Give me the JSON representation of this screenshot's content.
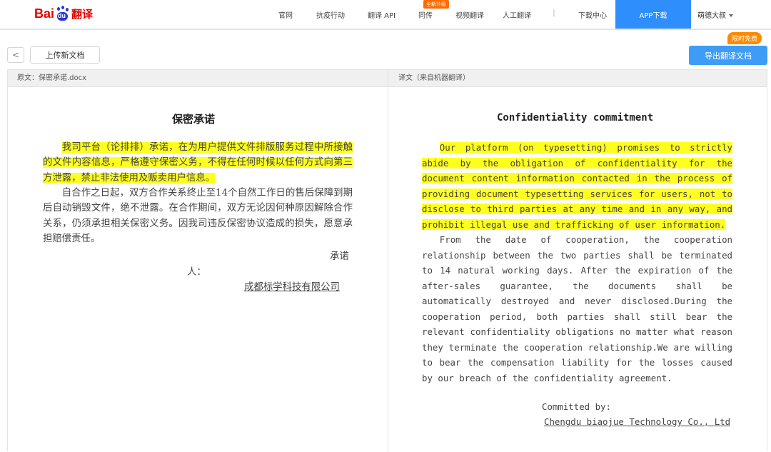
{
  "nav": {
    "logo_bai": "Bai",
    "logo_du": "du",
    "logo_fanyi": "翻译",
    "items": [
      "官网",
      "抗疫行动",
      "翻译 API",
      "同传",
      "视频翻译",
      "人工翻译"
    ],
    "separator": "|",
    "new_badge": "全新升级",
    "download_center": "下载中心",
    "app_download": "APP下载",
    "user_name": "萌德大叔"
  },
  "toolbar": {
    "back_glyph": "<",
    "upload_label": "上传新文档",
    "limited_badge": "限时免费",
    "export_label": "导出翻译文档"
  },
  "left_panel": {
    "header": "原文：保密承诺.docx",
    "title": "保密承诺",
    "para1": "我司平台（论排排）承诺，在为用户提供文件排版服务过程中所接触的文件内容信息，严格遵守保密义务，不得在任何时候以任何方式向第三方泄露，禁止非法使用及贩卖用户信息。",
    "para2": "自合作之日起，双方合作关系终止至14个自然工作日的售后保障到期后自动销毁文件，绝不泄露。在合作期间，双方无论因何种原因解除合作关系，仍须承担相关保密义务。因我司违反保密协议造成的损失，愿意承担赔偿责任。",
    "sig_part1": "承诺",
    "sig_part2": "人：",
    "company": "成都标学科技有限公司"
  },
  "right_panel": {
    "header": "译文（来自机器翻译）",
    "title": "Confidentiality commitment",
    "para1": "Our platform (on typesetting) promises to strictly abide by the obligation of confidentiality for the document content information contacted in the process of providing document typesetting services for users, not to disclose to third parties at any time and in any way, and prohibit illegal use and trafficking of user information.",
    "para2": "From the date of cooperation, the cooperation relationship between the two parties shall be terminated to 14 natural working days. After the expiration of the after-sales guarantee, the documents shall be automatically destroyed and never disclosed.During the cooperation period, both parties shall still bear the relevant confidentiality obligations no matter what reason they terminate the cooperation relationship.We are willing to bear the compensation liability for the losses caused by our breach of the confidentiality agreement.",
    "committed_by": "Committed by:",
    "company": "Chengdu biaojue Technology Co., Ltd"
  },
  "colors": {
    "highlight": "#ffff1f",
    "brand_red": "#e10602",
    "brand_blue": "#2932e1",
    "accent_blue": "#2e8efc",
    "badge_orange": "#ff8a00"
  }
}
